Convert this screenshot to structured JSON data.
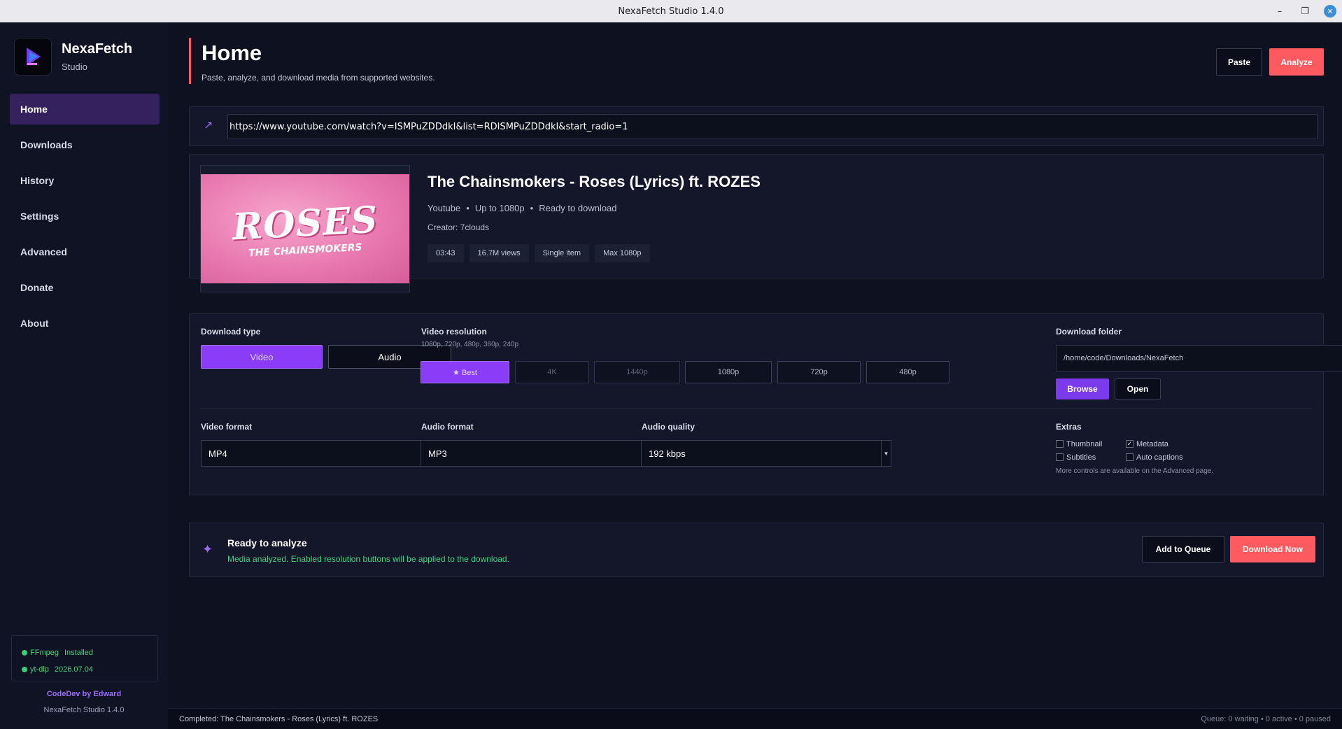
{
  "window": {
    "title": "NexaFetch Studio 1.4.0",
    "minimize": "–",
    "maximize": "❐",
    "close": "✕"
  },
  "sidebar": {
    "brand_name": "NexaFetch",
    "brand_sub": "Studio",
    "items": [
      {
        "label": "Home",
        "active": true
      },
      {
        "label": "Downloads"
      },
      {
        "label": "History"
      },
      {
        "label": "Settings"
      },
      {
        "label": "Advanced"
      },
      {
        "label": "Donate"
      },
      {
        "label": "About"
      }
    ],
    "status": [
      {
        "name": "FFmpeg",
        "value": "Installed"
      },
      {
        "name": "yt-dlp",
        "value": "2026.07.04"
      }
    ],
    "credit": "CodeDev by Edward",
    "version": "NexaFetch Studio 1.4.0"
  },
  "header": {
    "title": "Home",
    "subtitle": "Paste, analyze, and download media from supported websites.",
    "paste_label": "Paste",
    "analyze_label": "Analyze"
  },
  "url": {
    "icon": "arrow-up-right-icon",
    "value": "https://www.youtube.com/watch?v=ISMPuZDDdkI&list=RDISMPuZDDdkI&start_radio=1"
  },
  "media": {
    "thumb_big": "ROSES",
    "thumb_small": "THE CHAINSMOKERS",
    "title": "The Chainsmokers - Roses (Lyrics) ft. ROZES",
    "source": "Youtube",
    "quality": "Up to 1080p",
    "state": "Ready to download",
    "separator": "•",
    "creator": "Creator: 7clouds",
    "chips": [
      "03:43",
      "16.7M views",
      "Single item",
      "Max 1080p"
    ]
  },
  "options": {
    "download_type_label": "Download type",
    "video_label": "Video",
    "audio_label": "Audio",
    "resolution_label": "Video resolution",
    "resolution_hint": "1080p, 720p, 480p, 360p, 240p",
    "resolutions": [
      "★ Best",
      "4K",
      "1440p",
      "1080p",
      "720p",
      "480p"
    ],
    "folder_label": "Download folder",
    "folder_value": "/home/code/Downloads/NexaFetch",
    "browse_label": "Browse",
    "open_label": "Open",
    "video_format_label": "Video format",
    "video_format": "MP4",
    "audio_format_label": "Audio format",
    "audio_format": "MP3",
    "audio_quality_label": "Audio quality",
    "audio_quality": "192 kbps",
    "extras_label": "Extras",
    "extras": [
      {
        "label": "Thumbnail",
        "checked": false
      },
      {
        "label": "Metadata",
        "checked": true
      },
      {
        "label": "Subtitles",
        "checked": false
      },
      {
        "label": "Auto captions",
        "checked": false
      }
    ],
    "extras_hint": "More controls are available on the Advanced page."
  },
  "action": {
    "title": "Ready to analyze",
    "subtitle": "Media analyzed. Enabled resolution buttons will be applied to the download.",
    "queue_label": "Add to Queue",
    "download_label": "Download Now"
  },
  "statusbar": {
    "left": "Completed: The Chainsmokers - Roses (Lyrics) ft. ROZES",
    "right": "Queue: 0 waiting • 0 active • 0 paused"
  },
  "colors": {
    "accent": "#8b3cf7",
    "danger": "#ff5a5f",
    "success": "#4cd080"
  }
}
